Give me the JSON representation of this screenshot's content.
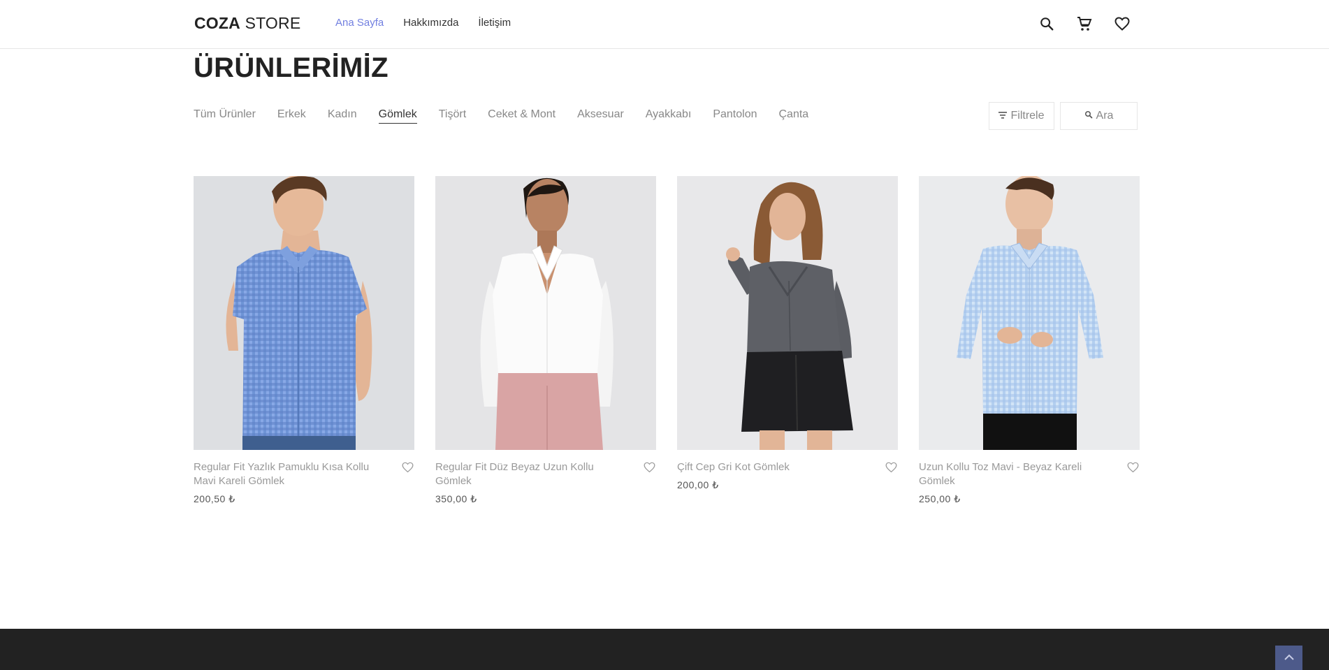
{
  "header": {
    "logo_bold": "COZA",
    "logo_light": "STORE",
    "nav": [
      {
        "label": "Ana Sayfa"
      },
      {
        "label": "Hakkımızda"
      },
      {
        "label": "İletişim"
      }
    ]
  },
  "page_title": "ÜRÜNLERİMİZ",
  "categories": [
    {
      "label": "Tüm Ürünler"
    },
    {
      "label": "Erkek"
    },
    {
      "label": "Kadın"
    },
    {
      "label": "Gömlek"
    },
    {
      "label": "Tişört"
    },
    {
      "label": "Ceket & Mont"
    },
    {
      "label": "Aksesuar"
    },
    {
      "label": "Ayakkabı"
    },
    {
      "label": "Pantolon"
    },
    {
      "label": "Çanta"
    }
  ],
  "active_category": "Gömlek",
  "tools": {
    "filter_label": "Filtrele",
    "search_label": "Ara"
  },
  "products": [
    {
      "name": "Regular Fit Yazlık Pamuklu Kısa Kollu Mavi Kareli Gömlek",
      "price": "200,50 ₺"
    },
    {
      "name": "Regular Fit Düz Beyaz Uzun Kollu Gömlek",
      "price": "350,00 ₺"
    },
    {
      "name": "Çift Cep Gri Kot Gömlek",
      "price": "200,00 ₺"
    },
    {
      "name": "Uzun Kollu Toz Mavi - Beyaz Kareli Gömlek",
      "price": "250,00 ₺"
    }
  ],
  "colors": {
    "accent": "#717fe0",
    "footer": "#222222",
    "back_to_top": "#4d5a8a"
  },
  "icons": [
    "search-icon",
    "cart-icon",
    "heart-icon",
    "filter-icon",
    "chevron-up-icon"
  ]
}
